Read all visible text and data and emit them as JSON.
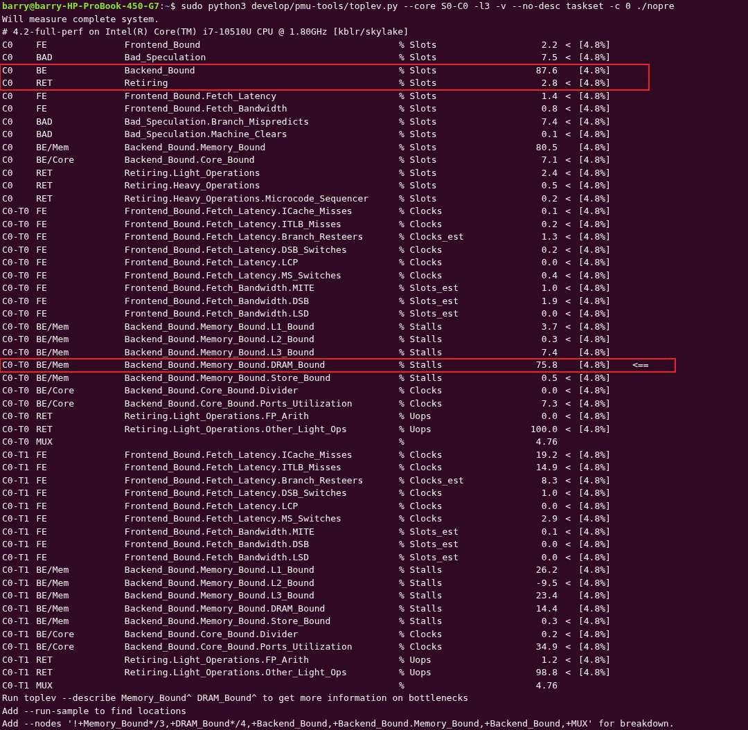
{
  "prompt": {
    "user_host": "barry@barry-HP-ProBook-450-G7",
    "separator": ":",
    "path": "~",
    "symbol": "$",
    "command": "sudo python3 develop/pmu-tools/toplev.py --core S0-C0 -l3 -v --no-desc taskset -c 0 ./nopre"
  },
  "header_lines": [
    "Will measure complete system.",
    "# 4.2-full-perf on Intel(R) Core(TM) i7-10510U CPU @ 1.80GHz [kblr/skylake]"
  ],
  "rows": [
    {
      "area": "C0",
      "type": "FE",
      "name": "Frontend_Bound",
      "unit": "% Slots",
      "value": "2.2",
      "flag": "<",
      "sample": "[4.8%]",
      "highlighted": false
    },
    {
      "area": "C0",
      "type": "BAD",
      "name": "Bad_Speculation",
      "unit": "% Slots",
      "value": "7.5",
      "flag": "<",
      "sample": "[4.8%]",
      "highlighted": false
    },
    {
      "area": "C0",
      "type": "BE",
      "name": "Backend_Bound",
      "unit": "% Slots",
      "value": "87.6",
      "sample": "[4.8%]",
      "highlighted": true
    },
    {
      "area": "C0",
      "type": "RET",
      "name": "Retiring",
      "unit": "% Slots",
      "value": "2.8",
      "flag": "<",
      "sample": "[4.8%]",
      "highlighted": true
    },
    {
      "area": "C0",
      "type": "FE",
      "name": "Frontend_Bound.Fetch_Latency",
      "unit": "% Slots",
      "value": "1.4",
      "flag": "<",
      "sample": "[4.8%]",
      "highlighted": false
    },
    {
      "area": "C0",
      "type": "FE",
      "name": "Frontend_Bound.Fetch_Bandwidth",
      "unit": "% Slots",
      "value": "0.8",
      "flag": "<",
      "sample": "[4.8%]",
      "highlighted": false
    },
    {
      "area": "C0",
      "type": "BAD",
      "name": "Bad_Speculation.Branch_Mispredicts",
      "unit": "% Slots",
      "value": "7.4",
      "flag": "<",
      "sample": "[4.8%]",
      "highlighted": false
    },
    {
      "area": "C0",
      "type": "BAD",
      "name": "Bad_Speculation.Machine_Clears",
      "unit": "% Slots",
      "value": "0.1",
      "flag": "<",
      "sample": "[4.8%]",
      "highlighted": false
    },
    {
      "area": "C0",
      "type": "BE/Mem",
      "name": "Backend_Bound.Memory_Bound",
      "unit": "% Slots",
      "value": "80.5",
      "sample": "[4.8%]",
      "highlighted": false
    },
    {
      "area": "C0",
      "type": "BE/Core",
      "name": "Backend_Bound.Core_Bound",
      "unit": "% Slots",
      "value": "7.1",
      "flag": "<",
      "sample": "[4.8%]",
      "highlighted": false
    },
    {
      "area": "C0",
      "type": "RET",
      "name": "Retiring.Light_Operations",
      "unit": "% Slots",
      "value": "2.4",
      "flag": "<",
      "sample": "[4.8%]",
      "highlighted": false
    },
    {
      "area": "C0",
      "type": "RET",
      "name": "Retiring.Heavy_Operations",
      "unit": "% Slots",
      "value": "0.5",
      "flag": "<",
      "sample": "[4.8%]",
      "highlighted": false
    },
    {
      "area": "C0",
      "type": "RET",
      "name": "Retiring.Heavy_Operations.Microcode_Sequencer",
      "unit": "% Slots",
      "value": "0.2",
      "flag": "<",
      "sample": "[4.8%]",
      "highlighted": false
    },
    {
      "area": "C0-T0",
      "type": "FE",
      "name": "Frontend_Bound.Fetch_Latency.ICache_Misses",
      "unit": "% Clocks",
      "value": "0.1",
      "flag": "<",
      "sample": "[4.8%]",
      "highlighted": false
    },
    {
      "area": "C0-T0",
      "type": "FE",
      "name": "Frontend_Bound.Fetch_Latency.ITLB_Misses",
      "unit": "% Clocks",
      "value": "0.2",
      "flag": "<",
      "sample": "[4.8%]",
      "highlighted": false
    },
    {
      "area": "C0-T0",
      "type": "FE",
      "name": "Frontend_Bound.Fetch_Latency.Branch_Resteers",
      "unit": "% Clocks_est",
      "value": "1.3",
      "flag": "<",
      "sample": "[4.8%]",
      "highlighted": false
    },
    {
      "area": "C0-T0",
      "type": "FE",
      "name": "Frontend_Bound.Fetch_Latency.DSB_Switches",
      "unit": "% Clocks",
      "value": "0.2",
      "flag": "<",
      "sample": "[4.8%]",
      "highlighted": false
    },
    {
      "area": "C0-T0",
      "type": "FE",
      "name": "Frontend_Bound.Fetch_Latency.LCP",
      "unit": "% Clocks",
      "value": "0.0",
      "flag": "<",
      "sample": "[4.8%]",
      "highlighted": false
    },
    {
      "area": "C0-T0",
      "type": "FE",
      "name": "Frontend_Bound.Fetch_Latency.MS_Switches",
      "unit": "% Clocks",
      "value": "0.4",
      "flag": "<",
      "sample": "[4.8%]",
      "highlighted": false
    },
    {
      "area": "C0-T0",
      "type": "FE",
      "name": "Frontend_Bound.Fetch_Bandwidth.MITE",
      "unit": "% Slots_est",
      "value": "1.0",
      "flag": "<",
      "sample": "[4.8%]",
      "highlighted": false
    },
    {
      "area": "C0-T0",
      "type": "FE",
      "name": "Frontend_Bound.Fetch_Bandwidth.DSB",
      "unit": "% Slots_est",
      "value": "1.9",
      "flag": "<",
      "sample": "[4.8%]",
      "highlighted": false
    },
    {
      "area": "C0-T0",
      "type": "FE",
      "name": "Frontend_Bound.Fetch_Bandwidth.LSD",
      "unit": "% Slots_est",
      "value": "0.0",
      "flag": "<",
      "sample": "[4.8%]",
      "highlighted": false
    },
    {
      "area": "C0-T0",
      "type": "BE/Mem",
      "name": "Backend_Bound.Memory_Bound.L1_Bound",
      "unit": "% Stalls",
      "value": "3.7",
      "flag": "<",
      "sample": "[4.8%]",
      "highlighted": false
    },
    {
      "area": "C0-T0",
      "type": "BE/Mem",
      "name": "Backend_Bound.Memory_Bound.L2_Bound",
      "unit": "% Stalls",
      "value": "0.3",
      "flag": "<",
      "sample": "[4.8%]",
      "highlighted": false
    },
    {
      "area": "C0-T0",
      "type": "BE/Mem",
      "name": "Backend_Bound.Memory_Bound.L3_Bound",
      "unit": "% Stalls",
      "value": "7.4",
      "sample": "[4.8%]",
      "highlighted": false
    },
    {
      "area": "C0-T0",
      "type": "BE/Mem",
      "name": "Backend_Bound.Memory_Bound.DRAM_Bound",
      "unit": "% Stalls",
      "value": "75.8",
      "sample": "[4.8%]",
      "marker": "<==",
      "highlighted": true
    },
    {
      "area": "C0-T0",
      "type": "BE/Mem",
      "name": "Backend_Bound.Memory_Bound.Store_Bound",
      "unit": "% Stalls",
      "value": "0.5",
      "flag": "<",
      "sample": "[4.8%]",
      "highlighted": false
    },
    {
      "area": "C0-T0",
      "type": "BE/Core",
      "name": "Backend_Bound.Core_Bound.Divider",
      "unit": "% Clocks",
      "value": "0.0",
      "flag": "<",
      "sample": "[4.8%]",
      "highlighted": false
    },
    {
      "area": "C0-T0",
      "type": "BE/Core",
      "name": "Backend_Bound.Core_Bound.Ports_Utilization",
      "unit": "% Clocks",
      "value": "7.3",
      "flag": "<",
      "sample": "[4.8%]",
      "highlighted": false
    },
    {
      "area": "C0-T0",
      "type": "RET",
      "name": "Retiring.Light_Operations.FP_Arith",
      "unit": "% Uops",
      "value": "0.0",
      "flag": "<",
      "sample": "[4.8%]",
      "highlighted": false
    },
    {
      "area": "C0-T0",
      "type": "RET",
      "name": "Retiring.Light_Operations.Other_Light_Ops",
      "unit": "% Uops",
      "value": "100.0",
      "flag": "<",
      "sample": "[4.8%]",
      "highlighted": false
    },
    {
      "area": "C0-T0",
      "type": "MUX",
      "unit": "%",
      "value": "4.76",
      "highlighted": false
    },
    {
      "area": "C0-T1",
      "type": "FE",
      "name": "Frontend_Bound.Fetch_Latency.ICache_Misses",
      "unit": "% Clocks",
      "value": "19.2",
      "flag": "<",
      "sample": "[4.8%]",
      "highlighted": false
    },
    {
      "area": "C0-T1",
      "type": "FE",
      "name": "Frontend_Bound.Fetch_Latency.ITLB_Misses",
      "unit": "% Clocks",
      "value": "14.9",
      "flag": "<",
      "sample": "[4.8%]",
      "highlighted": false
    },
    {
      "area": "C0-T1",
      "type": "FE",
      "name": "Frontend_Bound.Fetch_Latency.Branch_Resteers",
      "unit": "% Clocks_est",
      "value": "8.3",
      "flag": "<",
      "sample": "[4.8%]",
      "highlighted": false
    },
    {
      "area": "C0-T1",
      "type": "FE",
      "name": "Frontend_Bound.Fetch_Latency.DSB_Switches",
      "unit": "% Clocks",
      "value": "1.0",
      "flag": "<",
      "sample": "[4.8%]",
      "highlighted": false
    },
    {
      "area": "C0-T1",
      "type": "FE",
      "name": "Frontend_Bound.Fetch_Latency.LCP",
      "unit": "% Clocks",
      "value": "0.0",
      "flag": "<",
      "sample": "[4.8%]",
      "highlighted": false
    },
    {
      "area": "C0-T1",
      "type": "FE",
      "name": "Frontend_Bound.Fetch_Latency.MS_Switches",
      "unit": "% Clocks",
      "value": "2.9",
      "flag": "<",
      "sample": "[4.8%]",
      "highlighted": false
    },
    {
      "area": "C0-T1",
      "type": "FE",
      "name": "Frontend_Bound.Fetch_Bandwidth.MITE",
      "unit": "% Slots_est",
      "value": "0.1",
      "flag": "<",
      "sample": "[4.8%]",
      "highlighted": false
    },
    {
      "area": "C0-T1",
      "type": "FE",
      "name": "Frontend_Bound.Fetch_Bandwidth.DSB",
      "unit": "% Slots_est",
      "value": "0.0",
      "flag": "<",
      "sample": "[4.8%]",
      "highlighted": false
    },
    {
      "area": "C0-T1",
      "type": "FE",
      "name": "Frontend_Bound.Fetch_Bandwidth.LSD",
      "unit": "% Slots_est",
      "value": "0.0",
      "flag": "<",
      "sample": "[4.8%]",
      "highlighted": false
    },
    {
      "area": "C0-T1",
      "type": "BE/Mem",
      "name": "Backend_Bound.Memory_Bound.L1_Bound",
      "unit": "% Stalls",
      "value": "26.2",
      "sample": "[4.8%]",
      "highlighted": false
    },
    {
      "area": "C0-T1",
      "type": "BE/Mem",
      "name": "Backend_Bound.Memory_Bound.L2_Bound",
      "unit": "% Stalls",
      "value": "-9.5",
      "flag": "<",
      "sample": "[4.8%]",
      "highlighted": false
    },
    {
      "area": "C0-T1",
      "type": "BE/Mem",
      "name": "Backend_Bound.Memory_Bound.L3_Bound",
      "unit": "% Stalls",
      "value": "23.4",
      "sample": "[4.8%]",
      "highlighted": false
    },
    {
      "area": "C0-T1",
      "type": "BE/Mem",
      "name": "Backend_Bound.Memory_Bound.DRAM_Bound",
      "unit": "% Stalls",
      "value": "14.4",
      "sample": "[4.8%]",
      "highlighted": false
    },
    {
      "area": "C0-T1",
      "type": "BE/Mem",
      "name": "Backend_Bound.Memory_Bound.Store_Bound",
      "unit": "% Stalls",
      "value": "0.3",
      "flag": "<",
      "sample": "[4.8%]",
      "highlighted": false
    },
    {
      "area": "C0-T1",
      "type": "BE/Core",
      "name": "Backend_Bound.Core_Bound.Divider",
      "unit": "% Clocks",
      "value": "0.2",
      "flag": "<",
      "sample": "[4.8%]",
      "highlighted": false
    },
    {
      "area": "C0-T1",
      "type": "BE/Core",
      "name": "Backend_Bound.Core_Bound.Ports_Utilization",
      "unit": "% Clocks",
      "value": "34.9",
      "flag": "<",
      "sample": "[4.8%]",
      "highlighted": false
    },
    {
      "area": "C0-T1",
      "type": "RET",
      "name": "Retiring.Light_Operations.FP_Arith",
      "unit": "% Uops",
      "value": "1.2",
      "flag": "<",
      "sample": "[4.8%]",
      "highlighted": false
    },
    {
      "area": "C0-T1",
      "type": "RET",
      "name": "Retiring.Light_Operations.Other_Light_Ops",
      "unit": "% Uops",
      "value": "98.8",
      "flag": "<",
      "sample": "[4.8%]",
      "highlighted": false
    },
    {
      "area": "C0-T1",
      "type": "MUX",
      "unit": "%",
      "value": "4.76",
      "highlighted": false
    }
  ],
  "footer_lines": [
    "Run toplev --describe Memory_Bound^ DRAM_Bound^ to get more information on bottlenecks",
    "Add --run-sample to find locations",
    "Add --nodes '!+Memory_Bound*/3,+DRAM_Bound*/4,+Backend_Bound,+Backend_Bound.Memory_Bound,+Backend_Bound,+MUX' for breakdown."
  ]
}
